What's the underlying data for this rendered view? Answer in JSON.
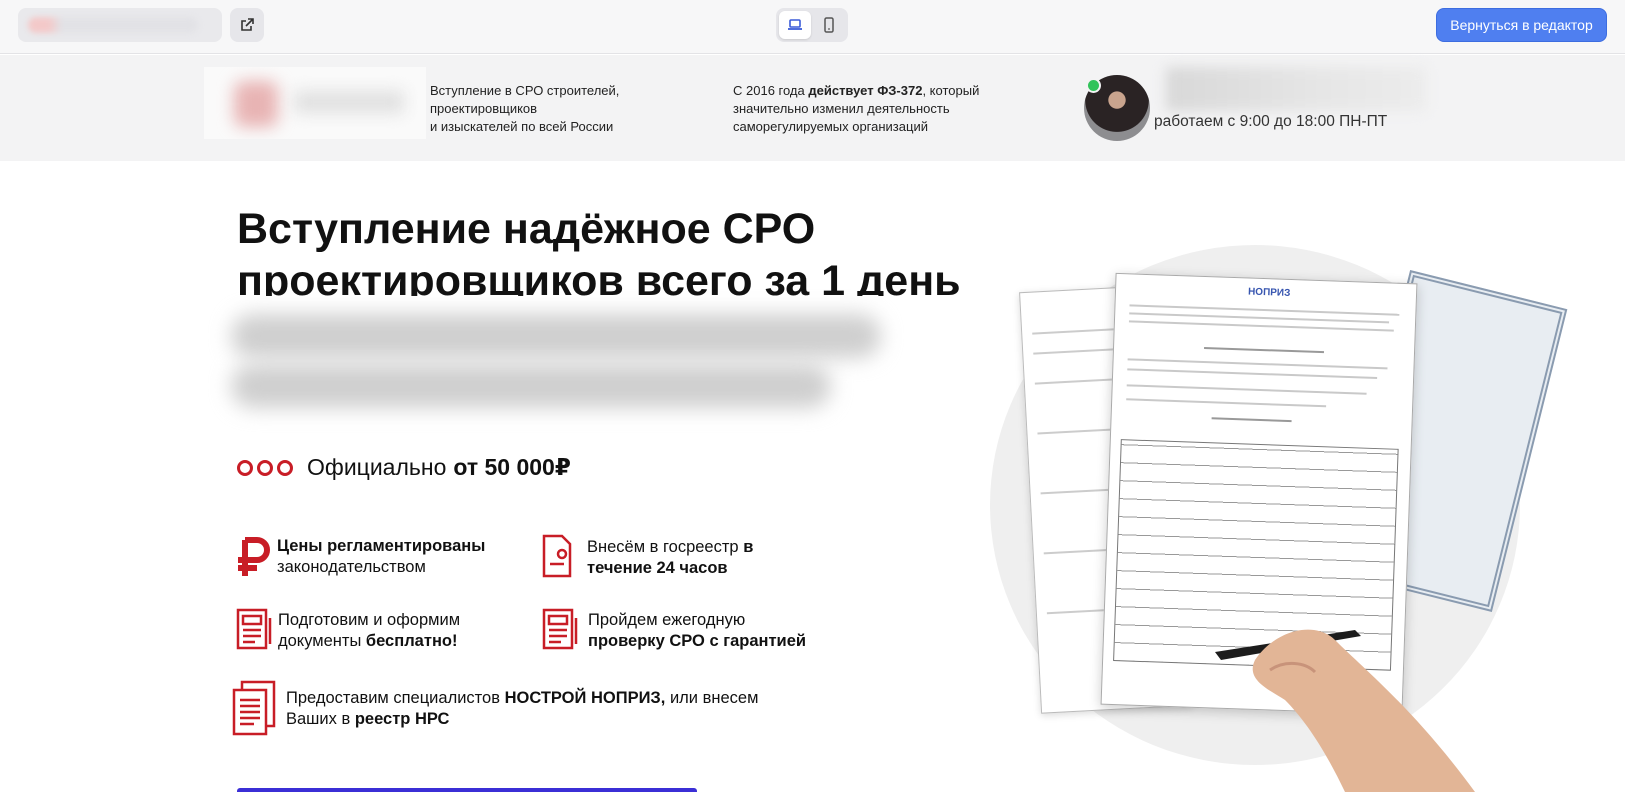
{
  "toolbar": {
    "device_desktop": "desktop-preview",
    "device_mobile": "mobile-preview",
    "back_button": "Вернуться в редактор"
  },
  "header": {
    "tagline_1": "Вступление в СРО строителей, проектировщиков и изыскателей по всей России",
    "tagline_1_lines": [
      "Вступление в СРО строителей,",
      "проектировщиков",
      "и изыскателей по всей России"
    ],
    "tagline_2": {
      "prefix": "С 2016 года ",
      "bold": "действует ФЗ-372",
      "suffix_line1": ", который",
      "line2": "значительно изменил деятельность",
      "line3": "саморегулируемых организаций"
    },
    "work_hours": "работаем с 9:00 до 18:00 ПН-ПТ"
  },
  "hero": {
    "title_line1": "Вступление надёжное СРО",
    "title_line2": "проектировщиков всего за 1 день",
    "price_prefix": "Официально",
    "price_bold": "от 50 000₽"
  },
  "features": [
    {
      "icon": "ruble-icon",
      "bold": "Цены регламентированы",
      "text": "законодательством"
    },
    {
      "icon": "registry-doc-icon",
      "text": "Внесём в госреестр ",
      "bold": "в",
      "bold2": "течение 24 часов"
    },
    {
      "icon": "document-icon",
      "text": "Подготовим и оформим",
      "text2": "документы ",
      "bold": "бесплатно!"
    },
    {
      "icon": "document-icon",
      "text": "Пройдем ежегодную",
      "bold": "проверку СРО с гарантией"
    },
    {
      "icon": "documents-stack-icon",
      "text": "Предоставим специалистов ",
      "bold": "НОСТРОЙ НОПРИЗ,",
      "text_after": " или внесем",
      "text2": "Ваших в ",
      "bold2": "реестр НРС"
    }
  ],
  "illustration": {
    "doc_header": "НОПРИЗ",
    "colors": {
      "accent": "#c81d26",
      "button": "#4f7ff0",
      "cta": "#3b2fd6"
    }
  }
}
